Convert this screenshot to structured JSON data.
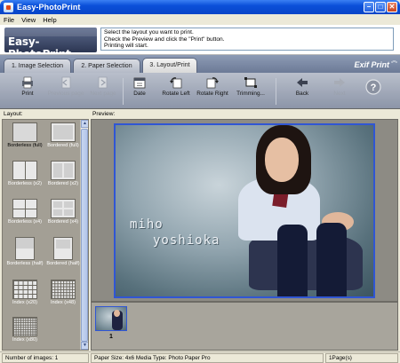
{
  "window": {
    "title": "Easy-PhotoPrint"
  },
  "menu": [
    {
      "label": "File"
    },
    {
      "label": "View"
    },
    {
      "label": "Help"
    }
  ],
  "header": {
    "logo_text": "Easy-PhotoPrint",
    "instructions": [
      "Select the layout you want to print.",
      "Check the Preview and click the \"Print\" button.",
      "Printing will start."
    ]
  },
  "tabs": [
    {
      "label": "1. Image Selection",
      "active": false
    },
    {
      "label": "2. Paper Selection",
      "active": false
    },
    {
      "label": "3. Layout/Print",
      "active": true
    }
  ],
  "brand": {
    "exif_label": "Exif Print"
  },
  "toolbar": {
    "print": {
      "label": "Print",
      "icon": "print-icon"
    },
    "previous_page": {
      "label": "Previous page",
      "icon": "previous-page-icon",
      "enabled": false
    },
    "next_page": {
      "label": "Next page",
      "icon": "next-page-icon",
      "enabled": false
    },
    "date": {
      "label": "Date",
      "icon": "calendar-icon"
    },
    "rotate_left": {
      "label": "Rotate Left",
      "icon": "rotate-left-icon"
    },
    "rotate_right": {
      "label": "Rotate Right",
      "icon": "rotate-right-icon"
    },
    "trimming": {
      "label": "Trimming...",
      "icon": "crop-icon"
    },
    "back": {
      "label": "Back",
      "icon": "back-arrow-icon"
    },
    "next": {
      "label": "Next",
      "icon": "next-arrow-icon",
      "enabled": false
    },
    "help": {
      "label": "?",
      "icon": "help-icon"
    }
  },
  "layout_panel": {
    "label": "Layout:",
    "items": [
      {
        "label": "Borderless (full)",
        "selected": true
      },
      {
        "label": "Bordered (full)",
        "selected": false
      },
      {
        "label": "Borderless (x2)",
        "selected": false
      },
      {
        "label": "Bordered (x2)",
        "selected": false
      },
      {
        "label": "Borderless (x4)",
        "selected": false
      },
      {
        "label": "Bordered (x4)",
        "selected": false
      },
      {
        "label": "Borderless (half)",
        "selected": false
      },
      {
        "label": "Bordered (half)",
        "selected": false
      },
      {
        "label": "Index (x20)",
        "selected": false
      },
      {
        "label": "Index (x48)",
        "selected": false
      },
      {
        "label": "Index (x80)",
        "selected": false
      }
    ]
  },
  "preview": {
    "label": "Preview:",
    "photo_text_line1": "miho",
    "photo_text_line2": "yoshioka",
    "page_number": "1"
  },
  "status": {
    "num_images": "Number of images: 1",
    "paper_info": "Paper Size: 4x6  Media Type: Photo Paper Pro",
    "pages": "1Page(s)"
  },
  "colors": {
    "accent": "#3056d4",
    "titlebar": "#0a4fd9"
  }
}
